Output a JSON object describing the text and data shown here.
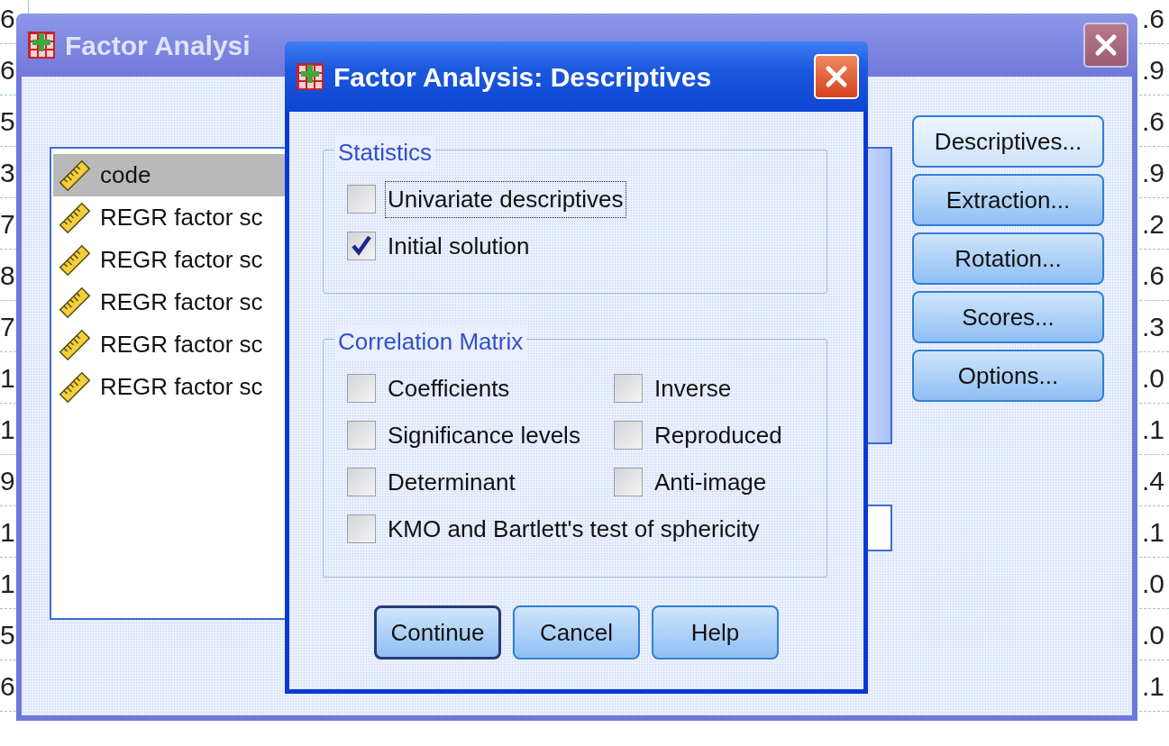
{
  "background_sheet": {
    "left_column": [
      "6",
      "6",
      "5",
      "3",
      "7",
      "8",
      "7",
      "1",
      "1",
      "9",
      "1",
      "1",
      "5",
      "6"
    ],
    "right_column": [
      ".6",
      ".9",
      ".6",
      ".9",
      ".2",
      ".6",
      ".3",
      ".0",
      ".1",
      ".4",
      ".1",
      ".0",
      ".0",
      ".1"
    ]
  },
  "main_window": {
    "title": "Factor Analysi",
    "active": false,
    "variables": [
      {
        "label": "code",
        "selected": true
      },
      {
        "label": "REGR factor sc",
        "selected": false
      },
      {
        "label": "REGR factor sc",
        "selected": false
      },
      {
        "label": "REGR factor sc",
        "selected": false
      },
      {
        "label": "REGR factor sc",
        "selected": false
      },
      {
        "label": "REGR factor sc",
        "selected": false
      }
    ],
    "buttons": [
      {
        "label": "Descriptives...",
        "highlighted": true
      },
      {
        "label": "Extraction...",
        "highlighted": false
      },
      {
        "label": "Rotation...",
        "highlighted": false
      },
      {
        "label": "Scores...",
        "highlighted": false
      },
      {
        "label": "Options...",
        "highlighted": false
      }
    ]
  },
  "dialog": {
    "title": "Factor Analysis: Descriptives",
    "active": true,
    "groups": [
      {
        "title": "Statistics",
        "kind": "list",
        "options": [
          {
            "label": "Univariate descriptives",
            "checked": false,
            "focused": true
          },
          {
            "label": "Initial solution",
            "checked": true,
            "focused": false
          }
        ]
      },
      {
        "title": "Correlation Matrix",
        "kind": "grid",
        "options": [
          {
            "label": "Coefficients",
            "checked": false,
            "focused": false
          },
          {
            "label": "Inverse",
            "checked": false,
            "focused": false
          },
          {
            "label": "Significance levels",
            "checked": false,
            "focused": false
          },
          {
            "label": "Reproduced",
            "checked": false,
            "focused": false
          },
          {
            "label": "Determinant",
            "checked": false,
            "focused": false
          },
          {
            "label": "Anti-image",
            "checked": false,
            "focused": false
          },
          {
            "label": "KMO and Bartlett's test of sphericity",
            "checked": false,
            "focused": false,
            "full_width": true
          }
        ]
      }
    ],
    "buttons": [
      {
        "label": "Continue",
        "default": true
      },
      {
        "label": "Cancel",
        "default": false
      },
      {
        "label": "Help",
        "default": false
      }
    ]
  }
}
